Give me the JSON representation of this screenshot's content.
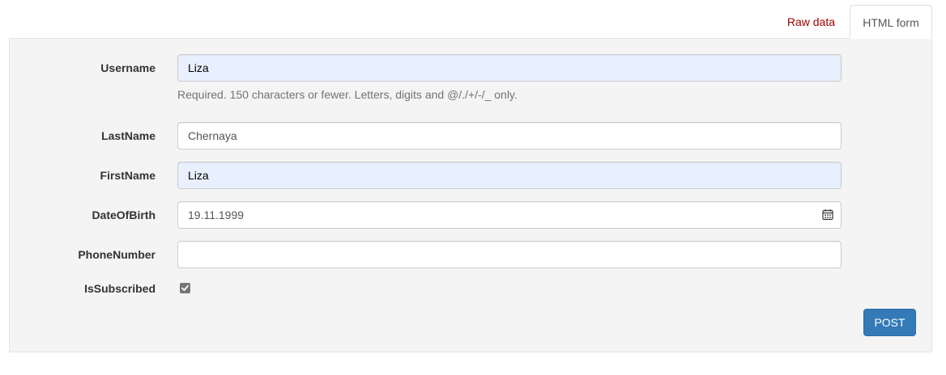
{
  "tabs": {
    "raw_label": "Raw data",
    "html_label": "HTML form"
  },
  "form": {
    "username": {
      "label": "Username",
      "value": "Liza",
      "help": "Required. 150 characters or fewer. Letters, digits and @/./+/-/_ only."
    },
    "last_name": {
      "label": "LastName",
      "value": "Chernaya"
    },
    "first_name": {
      "label": "FirstName",
      "value": "Liza"
    },
    "date_of_birth": {
      "label": "DateOfBirth",
      "value": "19.11.1999"
    },
    "phone_number": {
      "label": "PhoneNumber",
      "value": ""
    },
    "is_subscribed": {
      "label": "IsSubscribed",
      "checked": true
    },
    "submit_label": "POST"
  },
  "colors": {
    "accent": "#337ab7",
    "raw_tab": "#a00000",
    "autofill_bg": "#e8f0fe"
  }
}
